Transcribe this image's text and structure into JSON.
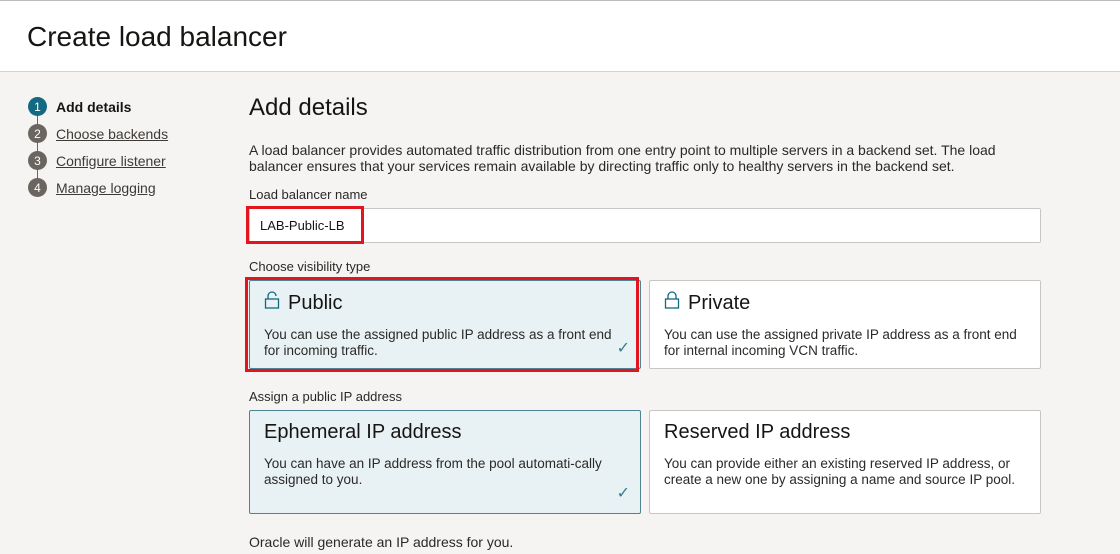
{
  "header": {
    "title": "Create load balancer"
  },
  "steps": [
    {
      "num": "1",
      "label": "Add details"
    },
    {
      "num": "2",
      "label": "Choose backends"
    },
    {
      "num": "3",
      "label": "Configure listener"
    },
    {
      "num": "4",
      "label": "Manage logging"
    }
  ],
  "main": {
    "title": "Add details",
    "description": "A load balancer provides automated traffic distribution from one entry point to multiple servers in a backend set. The load balancer ensures that your services remain available by directing traffic only to healthy servers in the backend set.",
    "name_label": "Load balancer name",
    "name_value": "LAB-Public-LB",
    "visibility_label": "Choose visibility type",
    "visibility": [
      {
        "title": "Public",
        "desc": "You can use the assigned public IP address as a front end for incoming traffic.",
        "selected": true
      },
      {
        "title": "Private",
        "desc": "You can use the assigned private IP address as a front end for internal incoming VCN traffic.",
        "selected": false
      }
    ],
    "ip_label": "Assign a public IP address",
    "ip": [
      {
        "title": "Ephemeral IP address",
        "desc": "You can have an IP address from the pool automati-cally assigned to you.",
        "selected": true
      },
      {
        "title": "Reserved IP address",
        "desc": "You can provide either an existing reserved IP address, or create a new one by assigning a name and source IP pool.",
        "selected": false
      }
    ],
    "footer": "Oracle will generate an IP address for you.",
    "check": "✓"
  },
  "colors": {
    "accent": "#136882",
    "highlight": "#e4141f"
  }
}
